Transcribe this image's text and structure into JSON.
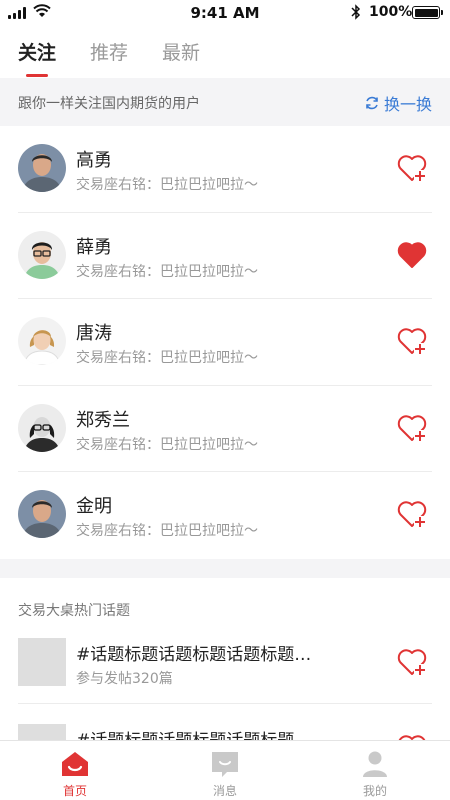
{
  "status_bar": {
    "time": "9:41 AM",
    "battery": "100%"
  },
  "tabs": [
    {
      "label": "关注",
      "active": true
    },
    {
      "label": "推荐",
      "active": false
    },
    {
      "label": "最新",
      "active": false
    }
  ],
  "recommend": {
    "hint": "跟你一样关注国内期货的用户",
    "swap_label": "换一换"
  },
  "users": [
    {
      "name": "高勇",
      "motto": "交易座右铭：巴拉巴拉吧拉～",
      "followed": false,
      "avatar_icon": "man-avatar-icon"
    },
    {
      "name": "薛勇",
      "motto": "交易座右铭：巴拉巴拉吧拉～",
      "followed": true,
      "avatar_icon": "man-glasses-avatar-icon"
    },
    {
      "name": "唐涛",
      "motto": "交易座右铭：巴拉巴拉吧拉～",
      "followed": false,
      "avatar_icon": "woman-avatar-icon"
    },
    {
      "name": "郑秀兰",
      "motto": "交易座右铭：巴拉巴拉吧拉～",
      "followed": false,
      "avatar_icon": "woman-glasses-avatar-icon"
    },
    {
      "name": "金明",
      "motto": "交易座右铭：巴拉巴拉吧拉～",
      "followed": false,
      "avatar_icon": "man-avatar-icon"
    }
  ],
  "topics": {
    "title": "交易大桌热门话题",
    "items": [
      {
        "title": "#话题标题话题标题话题标题…",
        "sub": "参与发帖320篇"
      },
      {
        "title": "#话题标题话题标题话题标题",
        "sub": ""
      }
    ]
  },
  "bottom_nav": [
    {
      "label": "首页",
      "icon": "home-icon",
      "active": true
    },
    {
      "label": "消息",
      "icon": "message-icon",
      "active": false
    },
    {
      "label": "我的",
      "icon": "profile-icon",
      "active": false
    }
  ],
  "colors": {
    "accent": "#e03434",
    "link": "#3a7bd5"
  }
}
